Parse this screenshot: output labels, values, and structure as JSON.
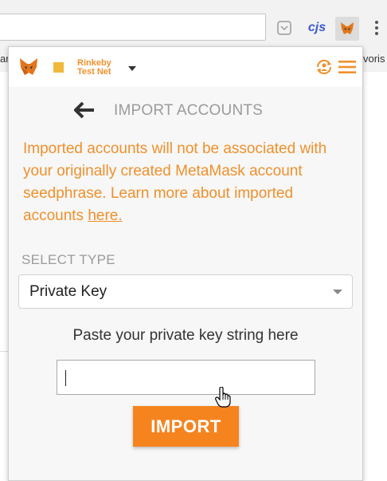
{
  "browser": {
    "bookmark_left": "ar",
    "bookmark_right": "voris",
    "ext_cjs": "cjs",
    "icons": [
      "pocket-icon",
      "metamask-fox-icon",
      "more-vert-icon"
    ]
  },
  "header": {
    "network_name": "Rinkeby\nTest Net",
    "network_color": "#f0b93c",
    "accent": "#f0902b",
    "icons": [
      "metamask-fox-icon",
      "account-switch-icon",
      "hamburger-menu-icon"
    ]
  },
  "page": {
    "title": "IMPORT ACCOUNTS",
    "notice_text": "Imported accounts will not be associated with your originally created MetaMask account seedphrase. Learn more about imported accounts ",
    "notice_link": "here.",
    "select_label": "SELECT TYPE",
    "select_value": "Private Key",
    "paste_label": "Paste your private key string here",
    "key_value": "",
    "import_button": "IMPORT",
    "button_color": "#f5841f"
  }
}
